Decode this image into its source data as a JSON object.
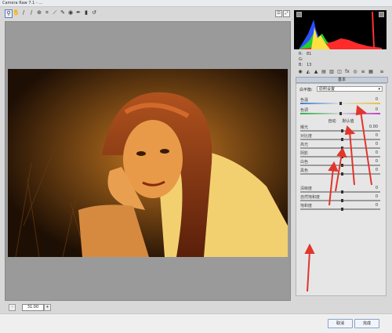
{
  "window": {
    "title": "Camera Raw 7.1 - ..."
  },
  "toolbar": {
    "tools": [
      {
        "name": "zoom-tool-icon",
        "glyph": "⚲"
      },
      {
        "name": "hand-tool-icon",
        "glyph": "✋"
      },
      {
        "name": "white-balance-tool-icon",
        "glyph": "∕"
      },
      {
        "name": "color-sampler-tool-icon",
        "glyph": "∕"
      },
      {
        "name": "targeted-adjustment-tool-icon",
        "glyph": "⊕"
      },
      {
        "name": "crop-tool-icon",
        "glyph": "⌗"
      },
      {
        "name": "straighten-tool-icon",
        "glyph": "⟋"
      },
      {
        "name": "spot-removal-tool-icon",
        "glyph": "✎"
      },
      {
        "name": "red-eye-tool-icon",
        "glyph": "◉"
      },
      {
        "name": "adjustment-brush-icon",
        "glyph": "✒"
      },
      {
        "name": "graduated-filter-icon",
        "glyph": "▮"
      },
      {
        "name": "rotate-icon",
        "glyph": "↺"
      }
    ]
  },
  "status": {
    "zoom": "31.00",
    "minus": "-",
    "plus": "+"
  },
  "histogram": {
    "r": "81",
    "g": "",
    "b": "13",
    "r_label": "R:",
    "g_label": "G:",
    "b_label": "B:"
  },
  "panel": {
    "header": "基本",
    "wb_label": "白平衡:",
    "wb_value": "原照设置",
    "auto_label": "自动",
    "default_label": "默认值",
    "sliders": [
      {
        "label": "色温",
        "value": "0",
        "pos": 0.5,
        "kind": "temp"
      },
      {
        "label": "色调",
        "value": "0",
        "pos": 0.5,
        "kind": "tint"
      },
      {
        "label": "曝光",
        "value": "0.00",
        "pos": 0.52,
        "kind": "plain"
      },
      {
        "label": "对比度",
        "value": "0",
        "pos": 0.52,
        "kind": "plain"
      },
      {
        "label": "高光",
        "value": "0",
        "pos": 0.52,
        "kind": "plain"
      },
      {
        "label": "阴影",
        "value": "0",
        "pos": 0.52,
        "kind": "plain"
      },
      {
        "label": "白色",
        "value": "0",
        "pos": 0.52,
        "kind": "plain"
      },
      {
        "label": "黑色",
        "value": "0",
        "pos": 0.52,
        "kind": "plain"
      },
      {
        "label": "清晰度",
        "value": "0",
        "pos": 0.52,
        "kind": "plain"
      },
      {
        "label": "自然饱和度",
        "value": "0",
        "pos": 0.52,
        "kind": "plain"
      },
      {
        "label": "饱和度",
        "value": "0",
        "pos": 0.52,
        "kind": "plain"
      }
    ]
  },
  "buttons": {
    "cancel": "取消",
    "done": "完成"
  },
  "colors": {
    "annotation": "#e0362c",
    "photo_dark": "#2a1606",
    "photo_light": "#f0c050"
  }
}
